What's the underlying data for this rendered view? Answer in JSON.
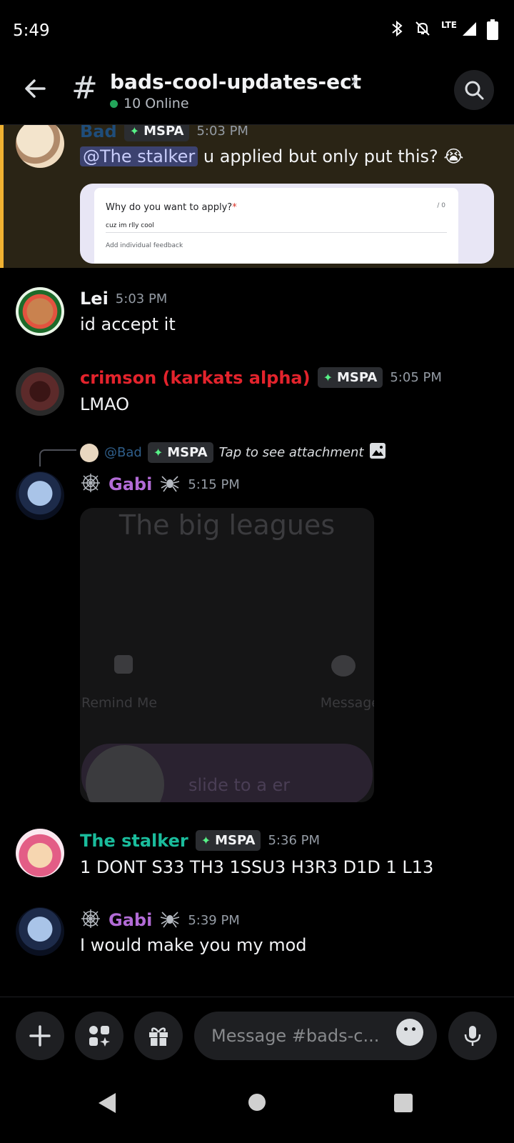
{
  "status_bar": {
    "time": "5:49",
    "network": "LTE"
  },
  "header": {
    "channel": "bads-cool-updates-ect",
    "online": "10 Online"
  },
  "messages": {
    "m1": {
      "author": "Bad",
      "badge": "MSPA",
      "time": "5:03 PM",
      "mention": "@The stalker",
      "text": " u  applied but only put this? 😭",
      "embed": {
        "question": "Why do you want to apply?",
        "required_mark": "*",
        "count": "/ 0",
        "answer": "cuz im rlly cool",
        "feedback": "Add individual feedback"
      }
    },
    "m2": {
      "author": "Lei",
      "time": "5:03 PM",
      "text": "id accept it"
    },
    "m3": {
      "author": "crimson (karkats alpha)",
      "badge": "MSPA",
      "time": "5:05 PM",
      "text": "LMAO"
    },
    "m4": {
      "reply_author": "@Bad",
      "reply_badge": "MSPA",
      "reply_text": "Tap to see attachment",
      "author": "Gabi",
      "time": "5:15 PM",
      "attachment": {
        "title": "The big leagues",
        "left_label": "Remind Me",
        "right_label": "Message",
        "slider_label": "slide to a      er"
      }
    },
    "m5": {
      "author": "The stalker",
      "badge": "MSPA",
      "time": "5:36 PM",
      "text": "1 DONT S33 TH3 1SSU3 H3R3 D1D 1 L13"
    },
    "m6": {
      "author": "Gabi",
      "time": "5:39 PM",
      "text": "I would make you my mod"
    }
  },
  "composer": {
    "placeholder": "Message #bads-c..."
  },
  "colors": {
    "accent_green": "#23a55a",
    "highlight_bar": "#f0b232",
    "crimson": "#e3232c",
    "gabi": "#b26bd6",
    "stalker": "#1abc9c"
  }
}
